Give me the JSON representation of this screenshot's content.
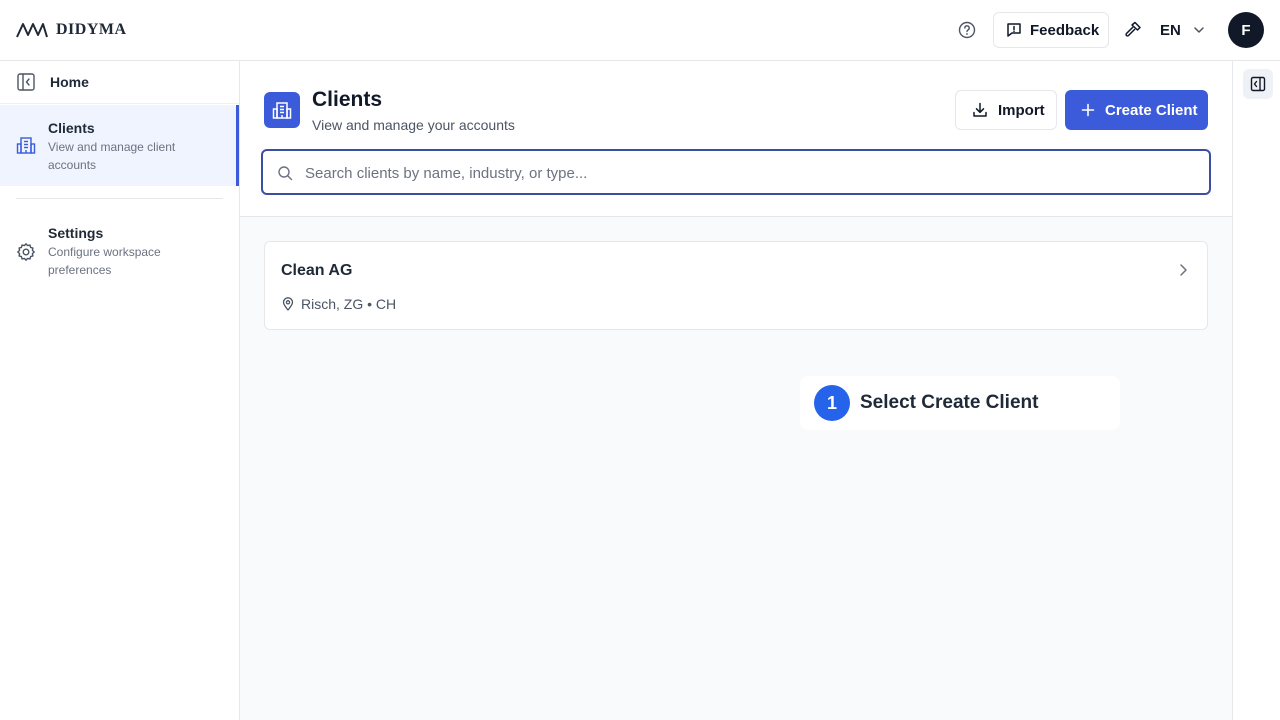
{
  "brand": {
    "name": "DIDYMA"
  },
  "topbar": {
    "feedback_label": "Feedback",
    "language": "EN",
    "avatar_initial": "F"
  },
  "sidebar": {
    "items": [
      {
        "title": "Home",
        "icon": "sidebar-collapse-icon"
      },
      {
        "title": "Clients",
        "subtitle": "View and manage client accounts",
        "icon": "building-icon",
        "active": true
      },
      {
        "title": "Settings",
        "subtitle": "Configure workspace preferences",
        "icon": "gear-icon"
      }
    ]
  },
  "page": {
    "title": "Clients",
    "subtitle": "View and manage your accounts",
    "import_label": "Import",
    "create_label": "Create Client"
  },
  "search": {
    "placeholder": "Search clients by name, industry, or type...",
    "value": ""
  },
  "clients": [
    {
      "name": "Clean AG",
      "location": "Risch, ZG • CH"
    }
  ],
  "callout": {
    "step": "1",
    "text": "Select Create Client"
  },
  "colors": {
    "accent": "#3b5bdb",
    "callout_badge": "#2563eb",
    "active_nav_bg": "#eff4ff"
  }
}
